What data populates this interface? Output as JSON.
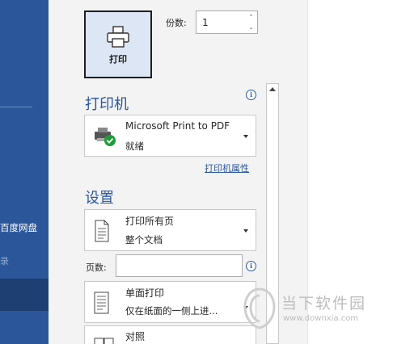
{
  "nav": {
    "baidu_label": "百度网盘",
    "partial_label": "录"
  },
  "print_button": {
    "label": "打印",
    "icon": "printer-icon"
  },
  "copies": {
    "label": "份数:",
    "value": "1"
  },
  "printer_section": {
    "title": "打印机",
    "selected_printer": "Microsoft Print to PDF",
    "status": "就绪",
    "properties_link": "打印机属性"
  },
  "settings_section": {
    "title": "设置",
    "print_range": {
      "title": "打印所有页",
      "subtitle": "整个文档"
    },
    "pages_label": "页数:",
    "pages_value": "",
    "sides": {
      "title": "单面打印",
      "subtitle": "仅在纸面的一侧上进..."
    },
    "collate": {
      "title": "对照"
    }
  },
  "watermark": {
    "title": "当下软件园",
    "url": "www.downxia.com"
  },
  "colors": {
    "nav": "#2b579a",
    "accent": "#2b579a",
    "print_button_bg": "#dde6f4",
    "status_ok": "#1e9c3a"
  }
}
